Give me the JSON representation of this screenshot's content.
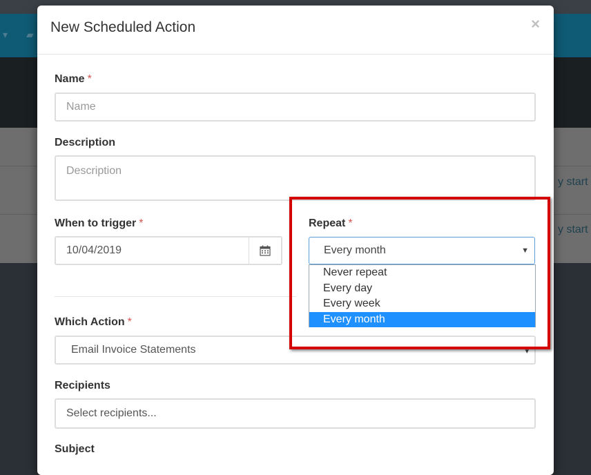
{
  "background": {
    "row_link_1": "y start",
    "row_link_2": "y start"
  },
  "modal": {
    "title": "New Scheduled Action",
    "close_glyph": "×"
  },
  "form": {
    "name": {
      "label": "Name",
      "required": "*",
      "placeholder": "Name"
    },
    "description": {
      "label": "Description",
      "placeholder": "Description"
    },
    "when": {
      "label": "When to trigger",
      "required": "*",
      "value": "10/04/2019",
      "icon": "calendar-icon"
    },
    "repeat": {
      "label": "Repeat",
      "required": "*",
      "value": "Every month",
      "options": [
        "Never repeat",
        "Every day",
        "Every week",
        "Every month"
      ],
      "selected_index": 3
    },
    "action": {
      "label": "Which Action",
      "required": "*",
      "value": "Email Invoice Statements"
    },
    "recipients": {
      "label": "Recipients",
      "placeholder": "Select recipients..."
    },
    "subject": {
      "label": "Subject"
    }
  },
  "colors": {
    "highlight": "#d40000",
    "selected_option": "#1e90ff",
    "required": "#d9534f"
  }
}
